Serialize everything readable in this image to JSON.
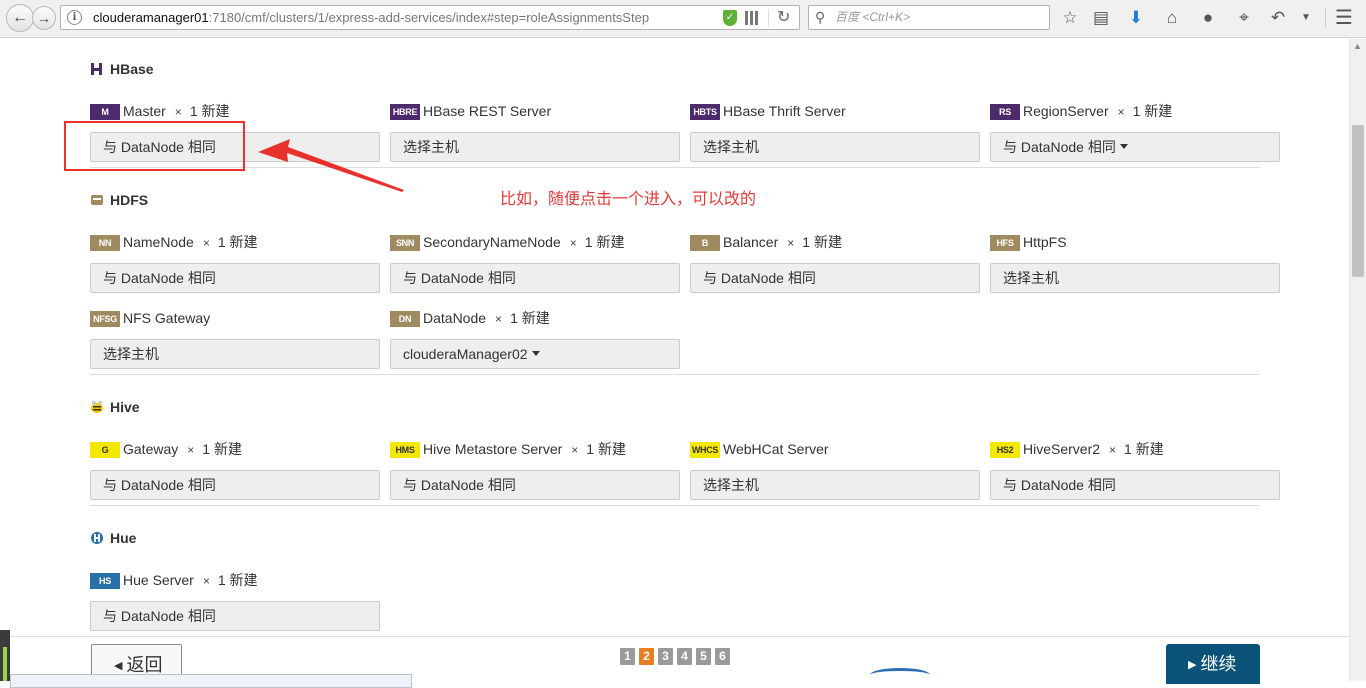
{
  "browser": {
    "url_host": "clouderamanager01",
    "url_path": ":7180/cmf/clusters/1/express-add-services/index#step=roleAssignmentsStep",
    "search_placeholder": "百度 <Ctrl+K>"
  },
  "sections": {
    "hbase": {
      "title": "HBase",
      "roles": [
        {
          "badge": "M",
          "name": "Master",
          "x": "×",
          "count": "1 新建",
          "value": "与 DataNode 相同",
          "caret": false
        },
        {
          "badge": "HBRE",
          "name": "HBase REST Server",
          "x": "",
          "count": "",
          "value": "选择主机",
          "caret": false
        },
        {
          "badge": "HBTS",
          "name": "HBase Thrift Server",
          "x": "",
          "count": "",
          "value": "选择主机",
          "caret": false
        },
        {
          "badge": "RS",
          "name": "RegionServer",
          "x": "×",
          "count": "1 新建",
          "value": "与 DataNode 相同",
          "caret": true
        }
      ]
    },
    "hdfs": {
      "title": "HDFS",
      "roles": [
        {
          "badge": "NN",
          "name": "NameNode",
          "x": "×",
          "count": "1 新建",
          "value": "与 DataNode 相同",
          "caret": false
        },
        {
          "badge": "SNN",
          "name": "SecondaryNameNode",
          "x": "×",
          "count": "1 新建",
          "value": "与 DataNode 相同",
          "caret": false
        },
        {
          "badge": "B",
          "name": "Balancer",
          "x": "×",
          "count": "1 新建",
          "value": "与 DataNode 相同",
          "caret": false
        },
        {
          "badge": "HFS",
          "name": "HttpFS",
          "x": "",
          "count": "",
          "value": "选择主机",
          "caret": false
        },
        {
          "badge": "NFSG",
          "name": "NFS Gateway",
          "x": "",
          "count": "",
          "value": "选择主机",
          "caret": false
        },
        {
          "badge": "DN",
          "name": "DataNode",
          "x": "×",
          "count": "1 新建",
          "value": "clouderaManager02",
          "caret": true
        }
      ]
    },
    "hive": {
      "title": "Hive",
      "roles": [
        {
          "badge": "G",
          "name": "Gateway",
          "x": "×",
          "count": "1 新建",
          "value": "与 DataNode 相同",
          "caret": false
        },
        {
          "badge": "HMS",
          "name": "Hive Metastore Server",
          "x": "×",
          "count": "1 新建",
          "value": "与 DataNode 相同",
          "caret": false
        },
        {
          "badge": "WHCS",
          "name": "WebHCat Server",
          "x": "",
          "count": "",
          "value": "选择主机",
          "caret": false
        },
        {
          "badge": "HS2",
          "name": "HiveServer2",
          "x": "×",
          "count": "1 新建",
          "value": "与 DataNode 相同",
          "caret": false
        }
      ]
    },
    "hue": {
      "title": "Hue",
      "roles": [
        {
          "badge": "HS",
          "name": "Hue Server",
          "x": "×",
          "count": "1 新建",
          "value": "与 DataNode 相同",
          "caret": false
        }
      ]
    }
  },
  "annotation": {
    "text": "比如，随便点击一个进入，可以改的"
  },
  "footer": {
    "back_label": "返回",
    "pages": [
      "1",
      "2",
      "3",
      "4",
      "5",
      "6"
    ],
    "active_page": "2",
    "continue_label": "继续"
  },
  "colors": {
    "accent": "#0b5279",
    "badge_purple": "#4c2a6c",
    "badge_tan": "#a08b61",
    "badge_yellow": "#f5e800",
    "annotation": "#e8302c"
  }
}
